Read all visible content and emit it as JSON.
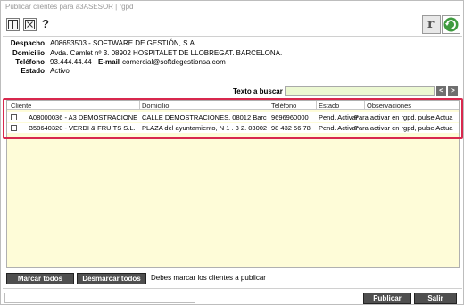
{
  "window": {
    "title": "Publicar clientes para a3ASESOR | rgpd"
  },
  "toolbar": {
    "help_glyph": "?",
    "r_glyph": "r"
  },
  "info": {
    "despacho_label": "Despacho",
    "despacho_value": "A08653503 - SOFTWARE DE GESTIÓN, S.A.",
    "domicilio_label": "Domicilio",
    "domicilio_value": "Avda. Camlet nº 3. 08902 HOSPITALET DE LLOBREGAT. BARCELONA.",
    "telefono_label": "Teléfono",
    "telefono_value": "93.444.44.44",
    "email_label": "E-mail",
    "email_value": "comercial@softdegestionsa.com",
    "estado_label": "Estado",
    "estado_value": "Activo"
  },
  "search": {
    "label": "Texto a buscar",
    "value": "",
    "prev": "<",
    "next": ">"
  },
  "grid": {
    "columns": [
      "Cliente",
      "Domicilio",
      "Teléfono",
      "Estado",
      "Observaciones"
    ],
    "rows": [
      {
        "cliente": "A08000036 - A3 DEMOSTRACIONE...",
        "domicilio": "CALLE DEMOSTRACIONES. 08012 Barce...",
        "telefono": "9696960000",
        "estado": "Pend. Activar",
        "obs": "Para activar en rgpd, pulse Actua"
      },
      {
        "cliente": "B58640320 - VERDI & FRUITS S.L.",
        "domicilio": "PLAZA del ayuntamiento, N 1 . 3 2. 03002 ...",
        "telefono": "98 432 56 78",
        "estado": "Pend. Activar",
        "obs": "Para activar en rgpd, pulse Actua"
      }
    ]
  },
  "footer": {
    "marcar": "Marcar todos",
    "desmarcar": "Desmarcar todos",
    "message": "Debes marcar los clientes a publicar",
    "publicar": "Publicar",
    "salir": "Salir"
  },
  "colors": {
    "highlight": "#d8284d",
    "grid_bg": "#fefcd8",
    "search_bg": "#ecf8d2",
    "button_dark": "#4f4f4f"
  },
  "icons": [
    "grid-icon",
    "close-x-icon",
    "help-icon",
    "r-icon",
    "refresh-icon",
    "arrow-left-icon",
    "arrow-right-icon"
  ]
}
